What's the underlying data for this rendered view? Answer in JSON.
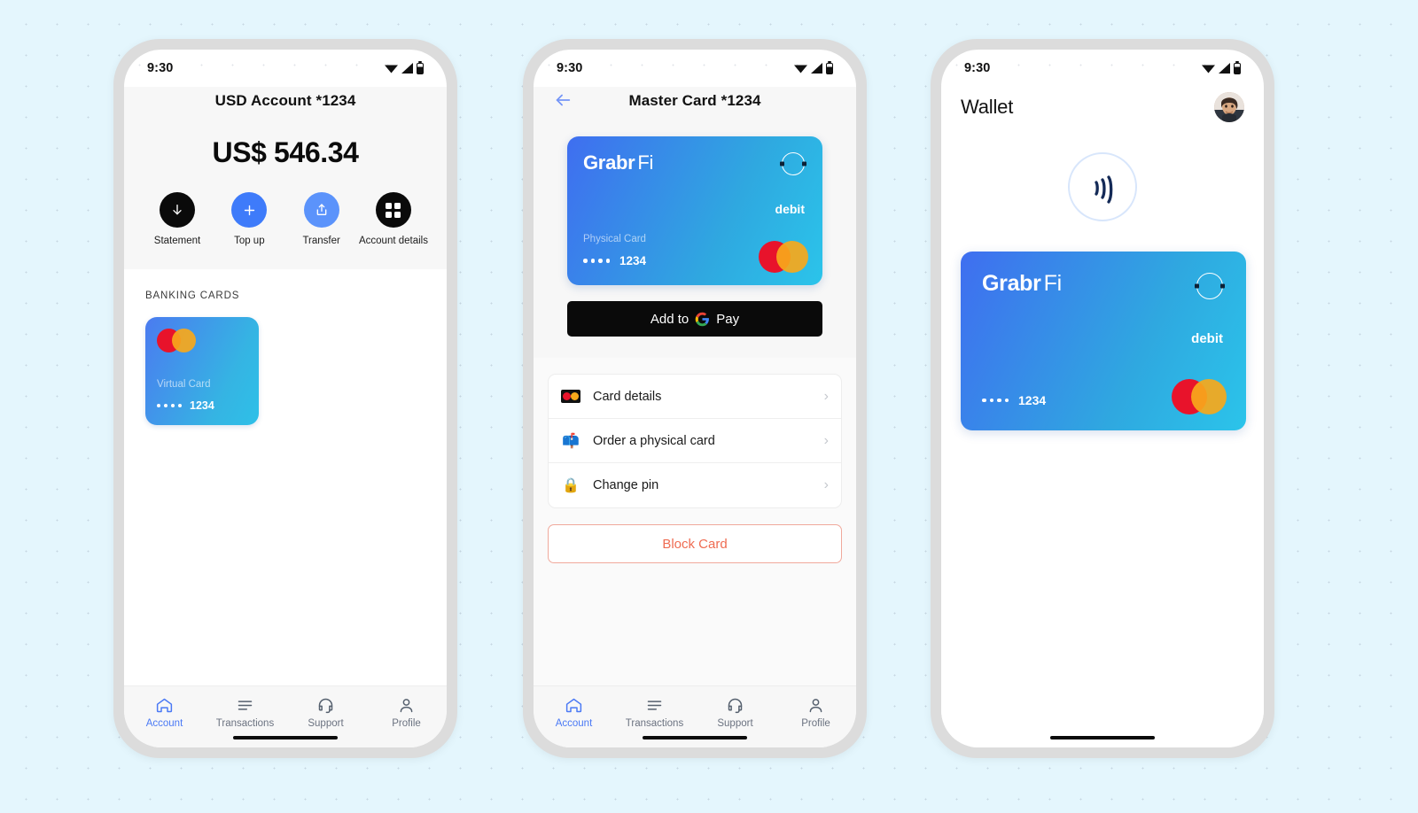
{
  "status_bar": {
    "time": "9:30",
    "icons": [
      "wifi-icon",
      "signal-icon",
      "battery-icon"
    ]
  },
  "colors": {
    "page_background": "#e4f6fd",
    "accent_blue": "#3e7bfa",
    "tab_active": "#4a79f5",
    "danger": "#ef6c52",
    "card_gradient_from": "#3f6ef0",
    "card_gradient_to": "#2bc4ea",
    "mastercard_red": "#e8132b",
    "mastercard_yellow": "#f7a81b",
    "black_button": "#0a0a0a"
  },
  "phone1": {
    "title": "USD Account *1234",
    "balance": "US$ 546.34",
    "actions": [
      {
        "label": "Statement",
        "icon": "download-arrow-icon",
        "style": "black"
      },
      {
        "label": "Top up",
        "icon": "plus-icon",
        "style": "blue"
      },
      {
        "label": "Transfer",
        "icon": "share-upload-icon",
        "style": "blue-light"
      },
      {
        "label": "Account details",
        "icon": "grid-squares-icon",
        "style": "black"
      }
    ],
    "section_label": "BANKING CARDS",
    "card": {
      "name": "Virtual Card",
      "masked": "••••",
      "last4": "1234",
      "network": "mastercard-logo"
    }
  },
  "phone2": {
    "title": "Master Card *1234",
    "back_icon": "back-arrow-icon",
    "card": {
      "brand_main": "Grabr",
      "brand_sub": "Fi",
      "type": "debit",
      "name": "Physical Card",
      "masked": "••••",
      "last4": "1234",
      "chip_icon": "contactless-chip-icon",
      "network": "mastercard-logo"
    },
    "gpay_button": {
      "text": "Add to",
      "suffix": "Pay",
      "icon": "google-g-icon"
    },
    "menu": [
      {
        "label": "Card details",
        "icon": "mastercard-badge-icon"
      },
      {
        "label": "Order a physical card",
        "icon": "mailbox-icon",
        "glyph": "📫"
      },
      {
        "label": "Change pin",
        "icon": "lock-icon",
        "glyph": "🔒"
      }
    ],
    "block_button": "Block Card"
  },
  "phone3": {
    "title": "Wallet",
    "avatar": "user-avatar",
    "nfc_icon": "contactless-nfc-icon",
    "card": {
      "brand_main": "Grabr",
      "brand_sub": "Fi",
      "type": "debit",
      "masked": "••••",
      "last4": "1234",
      "chip_icon": "contactless-chip-icon",
      "network": "mastercard-logo"
    }
  },
  "tabbar": {
    "items": [
      {
        "label": "Account",
        "icon": "home-icon",
        "active": true
      },
      {
        "label": "Transactions",
        "icon": "list-lines-icon",
        "active": false
      },
      {
        "label": "Support",
        "icon": "headset-icon",
        "active": false
      },
      {
        "label": "Profile",
        "icon": "person-icon",
        "active": false
      }
    ]
  }
}
